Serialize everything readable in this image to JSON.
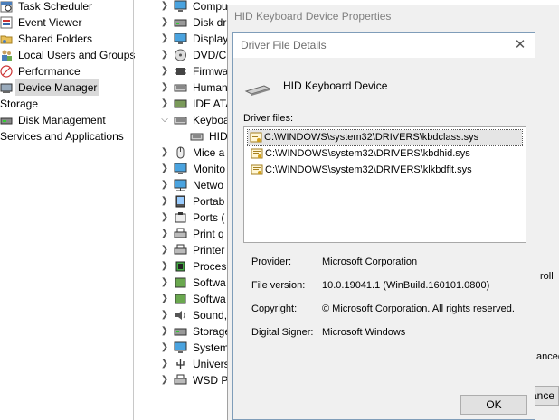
{
  "nav": {
    "items": [
      {
        "label": "Task Scheduler",
        "icon": "task-scheduler-icon"
      },
      {
        "label": "Event Viewer",
        "icon": "event-viewer-icon"
      },
      {
        "label": "Shared Folders",
        "icon": "shared-folders-icon"
      },
      {
        "label": "Local Users and Groups",
        "icon": "users-groups-icon"
      },
      {
        "label": "Performance",
        "icon": "performance-icon"
      },
      {
        "label": "Device Manager",
        "icon": "device-manager-icon",
        "selected": true
      },
      {
        "label": "Storage"
      },
      {
        "label": "Disk Management",
        "icon": "disk-management-icon"
      },
      {
        "label": "Services and Applications"
      }
    ]
  },
  "tree": {
    "nodes": [
      {
        "label": "Compu",
        "icon": "computer-icon"
      },
      {
        "label": "Disk dr",
        "icon": "disk-drive-icon"
      },
      {
        "label": "Display",
        "icon": "display-icon"
      },
      {
        "label": "DVD/C",
        "icon": "dvd-icon"
      },
      {
        "label": "Firmwa",
        "icon": "firmware-icon"
      },
      {
        "label": "Human",
        "icon": "hid-icon"
      },
      {
        "label": "IDE ATA",
        "icon": "ide-icon"
      },
      {
        "label": "Keyboa",
        "icon": "keyboard-icon",
        "expanded": true
      },
      {
        "label": "HID",
        "icon": "keyboard-device-icon",
        "child": true
      },
      {
        "label": "Mice a",
        "icon": "mouse-icon"
      },
      {
        "label": "Monito",
        "icon": "monitor-icon"
      },
      {
        "label": "Netwo",
        "icon": "network-icon"
      },
      {
        "label": "Portab",
        "icon": "portable-icon"
      },
      {
        "label": "Ports (",
        "icon": "ports-icon"
      },
      {
        "label": "Print q",
        "icon": "print-queue-icon"
      },
      {
        "label": "Printer",
        "icon": "printer-icon"
      },
      {
        "label": "Proces",
        "icon": "processor-icon"
      },
      {
        "label": "Softwa",
        "icon": "software-icon"
      },
      {
        "label": "Softwa",
        "icon": "software-device-icon"
      },
      {
        "label": "Sound,",
        "icon": "sound-icon"
      },
      {
        "label": "Storage",
        "icon": "storage-icon"
      },
      {
        "label": "System",
        "icon": "system-icon"
      },
      {
        "label": "Univers",
        "icon": "usb-icon"
      },
      {
        "label": "WSD P",
        "icon": "wsd-icon"
      }
    ]
  },
  "properties_window": {
    "title": "HID Keyboard Device Properties",
    "partial_texts": [
      "roll",
      "anced"
    ],
    "partial_button": "ance"
  },
  "dialog": {
    "title": "Driver File Details",
    "device_name": "HID Keyboard Device",
    "files_label": "Driver files:",
    "files": [
      "C:\\WINDOWS\\system32\\DRIVERS\\kbdclass.sys",
      "C:\\WINDOWS\\system32\\DRIVERS\\kbdhid.sys",
      "C:\\WINDOWS\\system32\\DRIVERS\\klkbdflt.sys"
    ],
    "selected_file_index": 0,
    "info": [
      {
        "label": "Provider:",
        "value": "Microsoft Corporation"
      },
      {
        "label": "File version:",
        "value": "10.0.19041.1 (WinBuild.160101.0800)"
      },
      {
        "label": "Copyright:",
        "value": "© Microsoft Corporation. All rights reserved."
      },
      {
        "label": "Digital Signer:",
        "value": "Microsoft Windows"
      }
    ],
    "ok_label": "OK"
  }
}
